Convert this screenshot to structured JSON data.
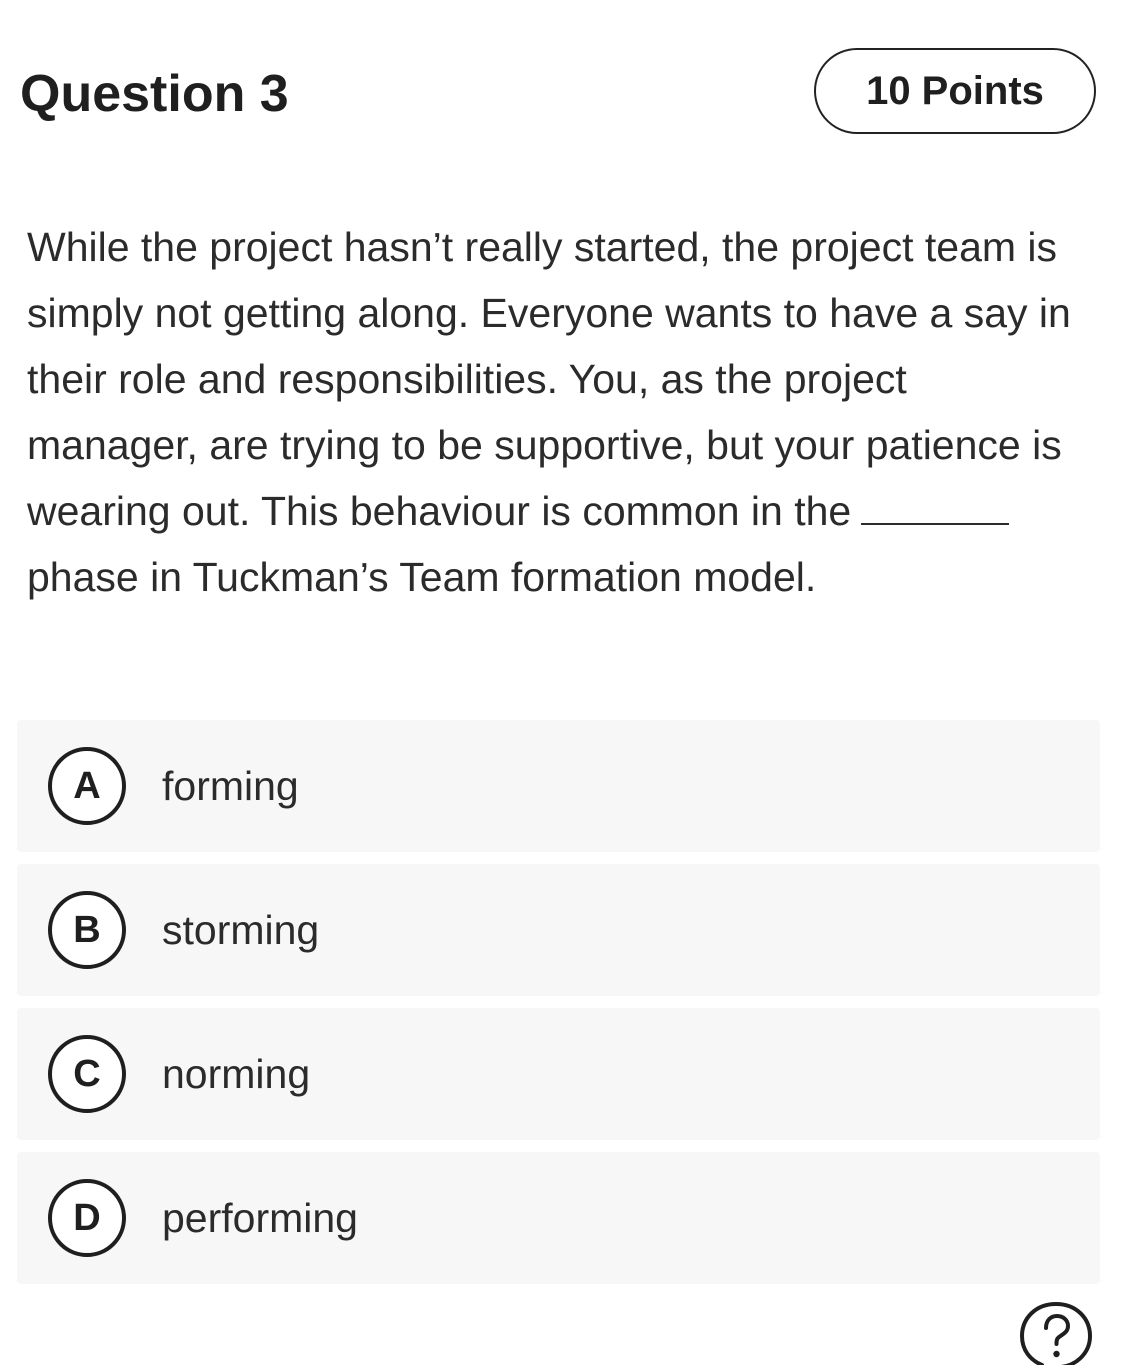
{
  "header": {
    "title": "Question 3",
    "points": "10 Points"
  },
  "question": {
    "text_before_blank": "While the project hasn’t really started, the project team is simply not getting along. Everyone wants to have a say in their role and responsibilities. You, as the project manager, are trying to be supportive, but your patience is wearing out. This behaviour is common in the",
    "text_after_blank": "phase in Tuckman’s Team formation model."
  },
  "options": [
    {
      "letter": "A",
      "text": "forming"
    },
    {
      "letter": "B",
      "text": "storming"
    },
    {
      "letter": "C",
      "text": "norming"
    },
    {
      "letter": "D",
      "text": "performing"
    }
  ],
  "help": {
    "icon": "help-icon"
  }
}
